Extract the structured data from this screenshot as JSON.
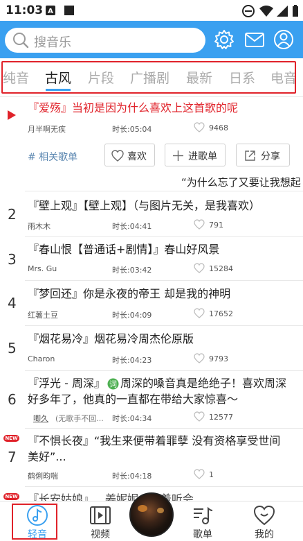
{
  "status_bar": {
    "time": "11:03"
  },
  "search": {
    "placeholder": "搜音乐"
  },
  "tabs": [
    {
      "label": "纯音"
    },
    {
      "label": "古风"
    },
    {
      "label": "片段"
    },
    {
      "label": "广播剧"
    },
    {
      "label": "最新"
    },
    {
      "label": "日系"
    },
    {
      "label": "电音"
    }
  ],
  "songs": [
    {
      "rank": "",
      "title": "『爱殇』当初是因为什么喜欢上这首歌的呢",
      "artist": "月半啊无疾",
      "duration": "时长:05:04",
      "likes": "9468"
    },
    {
      "rank": "2",
      "title": "『壁上观』【壁上观】（与图片无关，是我喜欢）",
      "artist": "雨木木",
      "duration": "时长:04:41",
      "likes": "791"
    },
    {
      "rank": "3",
      "title": "『春山恨【普通话+剧情】』春山好风景",
      "artist": "Mrs. Gu",
      "duration": "时长:03:42",
      "likes": "15284"
    },
    {
      "rank": "4",
      "title": "『梦回还』你是永夜的帝王 却是我的神明",
      "artist": "红薯土豆",
      "duration": "时长:04:09",
      "likes": "17652"
    },
    {
      "rank": "5",
      "title": "『烟花易冷』烟花易冷周杰伦原版",
      "artist": "Charon",
      "duration": "时长:04:23",
      "likes": "9793"
    },
    {
      "rank": "6",
      "title_line1": "『浮光 - 周深』",
      "title_line1b": "周深的嗓音真是绝绝子！喜欢周深",
      "title_line2": "好多年了，他真的一直都在带给大家惊喜～",
      "artist": "唧久",
      "artist_note": "(无歌手不回...",
      "duration": "时长:04:34",
      "likes": "12577"
    },
    {
      "rank": "7",
      "badge": "NEW",
      "title_line1": "『不惧长夜』“我生来便带着罪孽 没有资格享受世间",
      "title_line2": "美好”...",
      "artist": "鹤俐昀喘",
      "duration": "时长:04:18",
      "likes": "1"
    },
    {
      "badge": "NEW",
      "title_partial": "『长安姑娘』…姜妮妮…寻着听会"
    }
  ],
  "actions": {
    "related": "# 相关歌单",
    "like": "喜欢",
    "add_to_list": "进歌单",
    "share": "分享"
  },
  "comment_text": "“为什么忘了又要让我想起",
  "bottom_nav": [
    {
      "label": "轻音"
    },
    {
      "label": "视频"
    },
    {
      "label": "歌单"
    },
    {
      "label": "我的"
    }
  ],
  "colors": {
    "accent": "#3aa0f0",
    "highlight": "#e0222a"
  }
}
